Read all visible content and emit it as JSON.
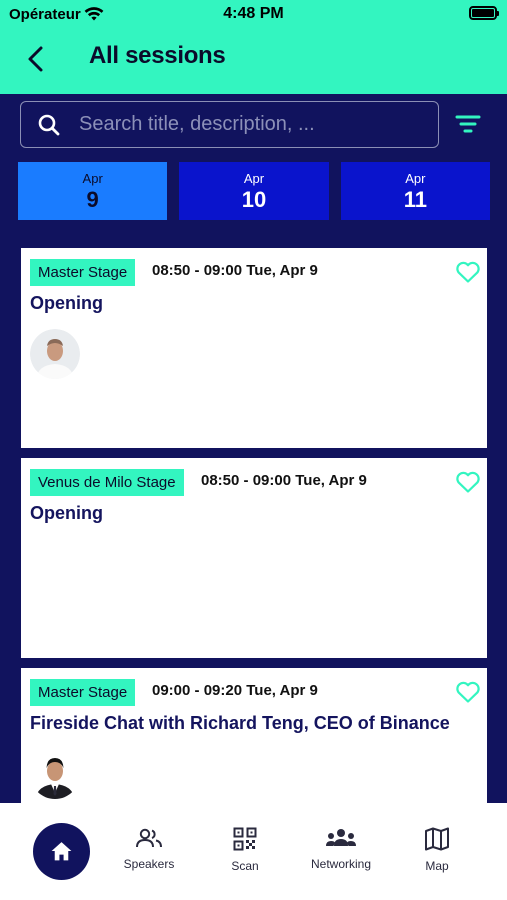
{
  "status": {
    "carrier": "Opérateur",
    "time": "4:48 PM"
  },
  "header": {
    "title": "All sessions"
  },
  "search": {
    "placeholder": "Search title, description, ..."
  },
  "dates": [
    {
      "month": "Apr",
      "day": "9"
    },
    {
      "month": "Apr",
      "day": "10"
    },
    {
      "month": "Apr",
      "day": "11"
    }
  ],
  "sessions": [
    {
      "stage": "Master Stage",
      "time": "08:50 - 09:00 Tue, Apr 9",
      "title": "Opening"
    },
    {
      "stage": "Venus de Milo Stage",
      "time": "08:50 - 09:00 Tue, Apr 9",
      "title": "Opening"
    },
    {
      "stage": "Master Stage",
      "time": "09:00 - 09:20 Tue, Apr 9",
      "title": "Fireside Chat with Richard Teng, CEO of Binance"
    }
  ],
  "nav": {
    "speakers": "Speakers",
    "scan": "Scan",
    "networking": "Networking",
    "map": "Map"
  },
  "colors": {
    "accent": "#33f5c0",
    "background": "#11135e",
    "date_tab": "#0a14cc",
    "date_tab_active": "#1a7cff"
  }
}
